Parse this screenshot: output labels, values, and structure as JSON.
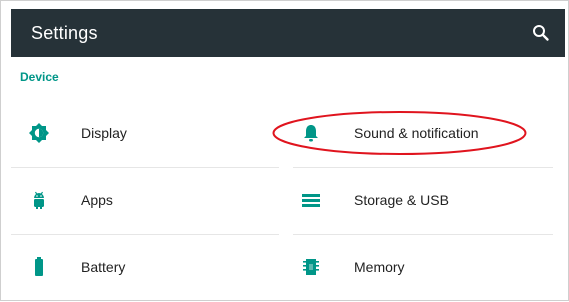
{
  "app_bar": {
    "title": "Settings",
    "search_icon": "search-icon"
  },
  "section": {
    "header": "Device"
  },
  "items": [
    {
      "label": "Display",
      "icon": "brightness-icon"
    },
    {
      "label": "Sound & notification",
      "icon": "bell-icon"
    },
    {
      "label": "Apps",
      "icon": "android-icon"
    },
    {
      "label": "Storage & USB",
      "icon": "storage-icon"
    },
    {
      "label": "Battery",
      "icon": "battery-icon"
    },
    {
      "label": "Memory",
      "icon": "memory-chip-icon"
    }
  ],
  "colors": {
    "app_bar_bg": "#263238",
    "accent": "#009688",
    "highlight_ellipse": "#e0141e"
  }
}
